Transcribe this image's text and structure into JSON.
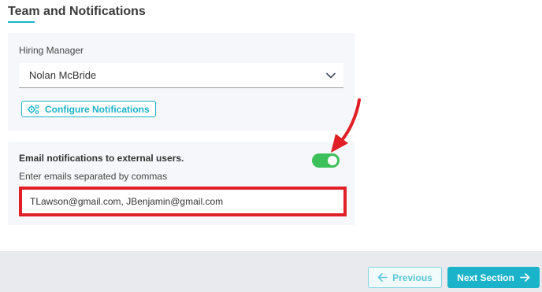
{
  "section": {
    "title": "Team and Notifications"
  },
  "hiring_manager": {
    "label": "Hiring Manager",
    "selected_value": "Nolan McBride",
    "configure_button_label": "Configure Notifications"
  },
  "external_email": {
    "title": "Email notifications to external users.",
    "toggle_on": true,
    "instructions": "Enter emails separated by commas",
    "input_value": "TLawson@gmail.com, JBenjamin@gmail.com"
  },
  "footer": {
    "previous_label": "Previous",
    "next_label": "Next Section"
  },
  "icons": {
    "dropdown": "chevron-down-icon",
    "configure": "gear-icon",
    "previous": "arrow-left-icon",
    "next": "arrow-right-icon",
    "annotation": "red-arrow-annotation-icon"
  },
  "colors": {
    "accent": "#1ab3c9",
    "toggle_on": "#3cc15a",
    "annotation": "#e01f26",
    "card_background": "#f6f7fa",
    "footer_background": "#e9eaee"
  }
}
